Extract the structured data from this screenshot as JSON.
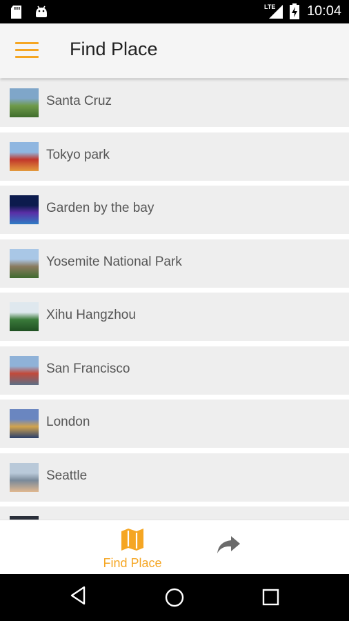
{
  "status_bar": {
    "time": "10:04",
    "network": "LTE",
    "icons": [
      "sd-card-icon",
      "android-icon",
      "signal-icon",
      "battery-charging-icon"
    ]
  },
  "app_bar": {
    "title": "Find Place",
    "menu_icon": "hamburger-menu-icon"
  },
  "places": [
    {
      "name": "Santa Cruz",
      "thumb_colors": [
        "#7fa6c9",
        "#6f9a4a",
        "#3f6d2c"
      ]
    },
    {
      "name": "Tokyo park",
      "thumb_colors": [
        "#8fb6e0",
        "#c2362b",
        "#e39a3c"
      ]
    },
    {
      "name": "Garden by the bay",
      "thumb_colors": [
        "#0c1b4d",
        "#5a2ea6",
        "#2f7cc4"
      ]
    },
    {
      "name": "Yosemite National Park",
      "thumb_colors": [
        "#a9c7e6",
        "#8a7a5e",
        "#3f6a2f"
      ]
    },
    {
      "name": "Xihu Hangzhou",
      "thumb_colors": [
        "#dfe8ee",
        "#3a7a3a",
        "#1f4f22"
      ]
    },
    {
      "name": "San Francisco",
      "thumb_colors": [
        "#8fb2d8",
        "#c24a3a",
        "#5c6f86"
      ]
    },
    {
      "name": "London",
      "thumb_colors": [
        "#6a86c0",
        "#d2a44e",
        "#2a3f6b"
      ]
    },
    {
      "name": "Seattle",
      "thumb_colors": [
        "#b9c9d9",
        "#7a8a9a",
        "#e0b890"
      ]
    },
    {
      "name": "",
      "thumb_colors": [
        "#2a2f3a",
        "#3a4050",
        "#1c2028"
      ]
    }
  ],
  "bottom_nav": {
    "find_place_label": "Find Place",
    "find_place_icon": "map-icon",
    "share_icon": "share-arrow-icon"
  },
  "system_nav": {
    "icons": [
      "back-icon",
      "home-icon",
      "recents-icon"
    ]
  },
  "colors": {
    "accent": "#f5a623",
    "app_bar_bg": "#f5f5f5",
    "row_bg": "#eeeeee",
    "row_text": "#555555",
    "title_text": "#212121"
  }
}
